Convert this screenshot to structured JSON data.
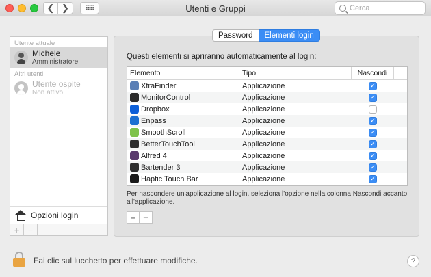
{
  "window": {
    "title": "Utenti e Gruppi",
    "search_placeholder": "Cerca",
    "back_glyph": "❮",
    "forward_glyph": "❯",
    "grid_glyph": "⠿⠿"
  },
  "sidebar": {
    "current_section_label": "Utente attuale",
    "current_user": {
      "name": "Michele",
      "role": "Amministratore"
    },
    "other_section_label": "Altri utenti",
    "other_users": [
      {
        "name": "Utente ospite",
        "status": "Non attivo"
      }
    ],
    "login_options_label": "Opzioni login",
    "plus_label": "+",
    "minus_label": "−"
  },
  "tabs": [
    {
      "label": "Password",
      "active": false
    },
    {
      "label": "Elementi login",
      "active": true
    }
  ],
  "login_items": {
    "description": "Questi elementi si apriranno automaticamente al login:",
    "columns": {
      "element": "Elemento",
      "type": "Tipo",
      "hide": "Nascondi"
    },
    "rows": [
      {
        "name": "XtraFinder",
        "type": "Applicazione",
        "hidden": true,
        "icon": "xtrafinder-icon",
        "color": "#5a7fb6"
      },
      {
        "name": "MonitorControl",
        "type": "Applicazione",
        "hidden": true,
        "icon": "monitorcontrol-icon",
        "color": "#2b2b2b"
      },
      {
        "name": "Dropbox",
        "type": "Applicazione",
        "hidden": false,
        "icon": "dropbox-icon",
        "color": "#0d5fd8"
      },
      {
        "name": "Enpass",
        "type": "Applicazione",
        "hidden": true,
        "icon": "enpass-icon",
        "color": "#1c6fd1"
      },
      {
        "name": "SmoothScroll",
        "type": "Applicazione",
        "hidden": true,
        "icon": "smoothscroll-icon",
        "color": "#7ec24a"
      },
      {
        "name": "BetterTouchTool",
        "type": "Applicazione",
        "hidden": true,
        "icon": "bettertouchtool-icon",
        "color": "#2d2d2d"
      },
      {
        "name": "Alfred 4",
        "type": "Applicazione",
        "hidden": true,
        "icon": "alfred-icon",
        "color": "#5b3b6e"
      },
      {
        "name": "Bartender 3",
        "type": "Applicazione",
        "hidden": true,
        "icon": "bartender-icon",
        "color": "#2e2e2e"
      },
      {
        "name": "Haptic Touch Bar",
        "type": "Applicazione",
        "hidden": true,
        "icon": "haptictouchbar-icon",
        "color": "#1a1a1a"
      }
    ],
    "hint": "Per nascondere un'applicazione al login, seleziona l'opzione nella colonna Nascondi accanto all'applicazione.",
    "plus_label": "+",
    "minus_label": "−"
  },
  "footer": {
    "lock_text": "Fai clic sul lucchetto per effettuare modifiche.",
    "help_label": "?"
  },
  "colors": {
    "accent": "#3b8df5",
    "lock": "#e9a442"
  }
}
